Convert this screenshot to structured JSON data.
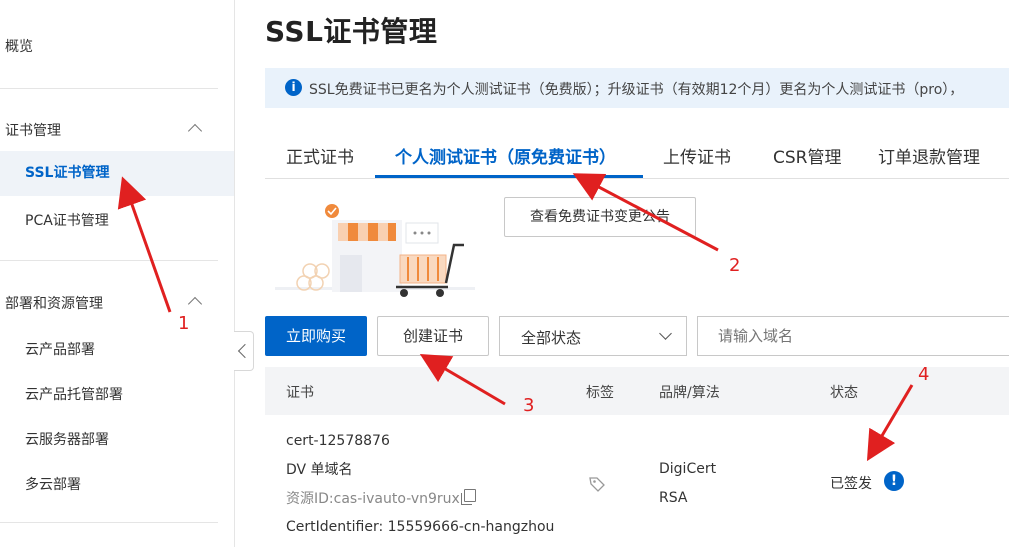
{
  "sidebar": {
    "overview": "概览",
    "group_cert": "证书管理",
    "items_cert": [
      "SSL证书管理",
      "PCA证书管理"
    ],
    "group_deploy": "部署和资源管理",
    "items_deploy": [
      "云产品部署",
      "云产品托管部署",
      "云服务器部署",
      "多云部署"
    ]
  },
  "page": {
    "title": "SSL证书管理",
    "notice": "SSL免费证书已更名为个人测试证书（免费版）；升级证书（有效期12个月）更名为个人测试证书（pro），"
  },
  "tabs": [
    "正式证书",
    "个人测试证书（原免费证书）",
    "上传证书",
    "CSR管理",
    "订单退款管理"
  ],
  "notice_button": "查看免费证书变更公告",
  "toolbar": {
    "buy": "立即购买",
    "create": "创建证书",
    "status_select": "全部状态",
    "search_placeholder": "请输入域名"
  },
  "table": {
    "headers": [
      "证书",
      "标签",
      "品牌/算法",
      "状态"
    ],
    "rows": [
      {
        "name": "cert-12578876",
        "type": "DV 单域名",
        "resource_id": "资源ID:cas-ivauto-vn9rux",
        "cert_identifier": "CertIdentifier: 15559666-cn-hangzhou",
        "brand": "DigiCert",
        "algorithm": "RSA",
        "status": "已签发"
      }
    ]
  },
  "annotations": [
    "1",
    "2",
    "3",
    "4"
  ],
  "colors": {
    "accent": "#0064c8",
    "annotation": "#e02020",
    "notice_bg": "#e9f2fb",
    "sidebar_active_bg": "#eff3f8"
  },
  "icons": [
    "chevron-up-icon",
    "chevron-left-icon",
    "info-icon",
    "chevron-down-icon",
    "copy-icon",
    "tag-icon",
    "warning-icon"
  ]
}
